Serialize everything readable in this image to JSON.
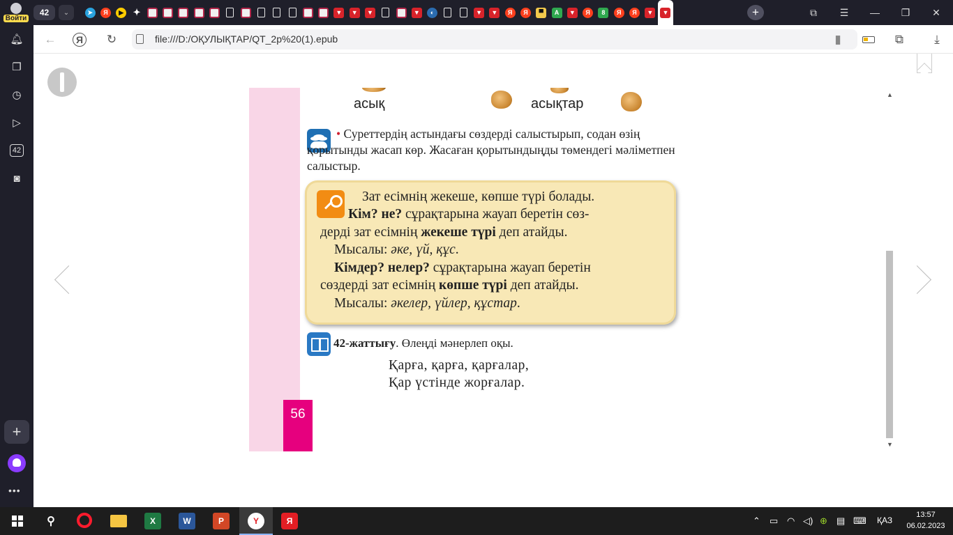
{
  "browser": {
    "profile_label": "Войти",
    "tab_count": "42",
    "url": "file:///D:/ОҚУЛЫҚТАР/QT_2р%20(1).epub",
    "tabs": [
      {
        "icon": "telegram-icon",
        "cls": "f-tg",
        "g": "➤"
      },
      {
        "icon": "yandex-icon",
        "cls": "f-ya",
        "g": "Я"
      },
      {
        "icon": "play-icon",
        "cls": "f-pl",
        "g": "▶"
      },
      {
        "icon": "sparkle-icon",
        "cls": "f-st",
        "g": "✦"
      },
      {
        "icon": "wildberries-icon",
        "cls": "f-w",
        "g": ""
      },
      {
        "icon": "wildberries-icon",
        "cls": "f-w",
        "g": ""
      },
      {
        "icon": "wildberries-icon",
        "cls": "f-w",
        "g": ""
      },
      {
        "icon": "wildberries-icon",
        "cls": "f-w",
        "g": ""
      },
      {
        "icon": "wildberries-icon",
        "cls": "f-w",
        "g": ""
      },
      {
        "icon": "document-icon",
        "cls": "f-d",
        "g": ""
      },
      {
        "icon": "wildberries-icon",
        "cls": "f-w",
        "g": ""
      },
      {
        "icon": "document-icon",
        "cls": "f-d",
        "g": ""
      },
      {
        "icon": "document-icon",
        "cls": "f-d",
        "g": ""
      },
      {
        "icon": "document-icon",
        "cls": "f-d",
        "g": ""
      },
      {
        "icon": "wildberries-icon",
        "cls": "f-w",
        "g": ""
      },
      {
        "icon": "wildberries-icon",
        "cls": "f-w",
        "g": ""
      },
      {
        "icon": "video-icon",
        "cls": "f-v",
        "g": "▼"
      },
      {
        "icon": "video-icon",
        "cls": "f-v",
        "g": "▼"
      },
      {
        "icon": "video-icon",
        "cls": "f-v",
        "g": "▼"
      },
      {
        "icon": "document-icon",
        "cls": "f-d",
        "g": ""
      },
      {
        "icon": "wildberries-icon",
        "cls": "f-w",
        "g": ""
      },
      {
        "icon": "video-icon",
        "cls": "f-v",
        "g": "▼"
      },
      {
        "icon": "globe-icon",
        "cls": "f-gl",
        "g": "◐"
      },
      {
        "icon": "document-icon",
        "cls": "f-d",
        "g": ""
      },
      {
        "icon": "document-icon",
        "cls": "f-d",
        "g": ""
      },
      {
        "icon": "video-icon",
        "cls": "f-v",
        "g": "▼"
      },
      {
        "icon": "video-icon",
        "cls": "f-v",
        "g": "▼"
      },
      {
        "icon": "yandex-icon",
        "cls": "f-ya",
        "g": "Я"
      },
      {
        "icon": "yandex-icon",
        "cls": "f-ya",
        "g": "Я"
      },
      {
        "icon": "yellow-icon",
        "cls": "f-yb",
        "g": "▀"
      },
      {
        "icon": "green-a-icon",
        "cls": "f-gr",
        "g": "A"
      },
      {
        "icon": "video-icon",
        "cls": "f-v",
        "g": "▼"
      },
      {
        "icon": "yandex-icon",
        "cls": "f-ya",
        "g": "Я"
      },
      {
        "icon": "green-circle-icon",
        "cls": "f-gr",
        "g": "8"
      },
      {
        "icon": "yandex-icon",
        "cls": "f-ya",
        "g": "Я"
      },
      {
        "icon": "yandex-icon",
        "cls": "f-ya",
        "g": "Я"
      },
      {
        "icon": "video-icon",
        "cls": "f-v",
        "g": "▼"
      }
    ]
  },
  "sidebar": {
    "count_badge": "42"
  },
  "page": {
    "number": "56",
    "word_singular": "асық",
    "word_plural": "асықтар",
    "task_bullet": "•",
    "task_text": "Суреттердің астындағы сөздерді салыстырып, содан өзің қорытынды жасап көр. Жасаған қорытындыңды төмендегі мәліметпен салыстыр.",
    "rule": {
      "l1": "Зат есімнің жекеше, көпше түрі болады.",
      "l2_b": "Кім? не?",
      "l2_r": " сұрақтарына жауап беретін сөз-",
      "l3_r1": "дерді зат есімнің ",
      "l3_b": "жекеше түрі",
      "l3_r2": " деп атайды.",
      "l4_r": "Мысалы: ",
      "l4_i": "әке, үй, құс",
      "l4_e": ".",
      "l5_b": "Кімдер? нелер?",
      "l5_r": " сұрақтарына жауап беретін",
      "l6_r1": "сөздерді зат есімнің ",
      "l6_b": "көпше түрі",
      "l6_r2": " деп атайды.",
      "l7_r": "Мысалы: ",
      "l7_i": "әкелер, үйлер, құстар",
      "l7_e": "."
    },
    "exercise_title_b": "42-жаттығу",
    "exercise_title_r": ". Өлеңді мәнерлеп оқы.",
    "poem_1": "Қарға, қарға, қарғалар,",
    "poem_2": "Қар үстінде жорғалар."
  },
  "taskbar": {
    "lang": "ҚАЗ",
    "time": "13:57",
    "date": "06.02.2023"
  }
}
